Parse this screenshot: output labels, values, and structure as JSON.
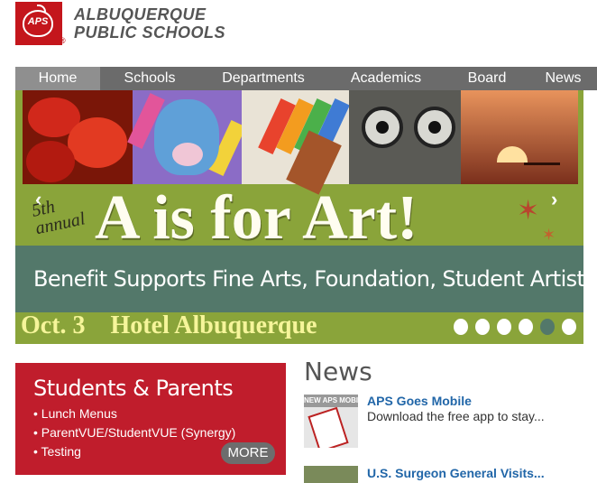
{
  "header": {
    "logo_text": "APS",
    "org_name_line1": "ALBUQUERQUE",
    "org_name_line2": "PUBLIC SCHOOLS",
    "registered_mark": "®"
  },
  "nav": {
    "items": [
      {
        "label": "Home",
        "active": true
      },
      {
        "label": "Schools"
      },
      {
        "label": "Departments"
      },
      {
        "label": "Academics"
      },
      {
        "label": "Board"
      },
      {
        "label": "News"
      }
    ]
  },
  "banner": {
    "prev_arrow": "‹",
    "next_arrow": "›",
    "annual_line1": "5th",
    "annual_line2": "annual",
    "headline": "A is for Art!",
    "subtitle": "Benefit Supports Fine Arts, Foundation, Student Artists",
    "event_date": "Oct. 3",
    "event_venue": "Hotel Albuquerque",
    "slide_count": 6,
    "active_slide": 5
  },
  "students_parents": {
    "title": "Students & Parents",
    "links": [
      "Lunch Menus",
      "ParentVUE/StudentVUE (Synergy)",
      "Testing"
    ],
    "more_label": "MORE"
  },
  "news": {
    "heading": "News",
    "items": [
      {
        "title": "APS Goes Mobile",
        "snippet": "Download the free app to stay...",
        "thumb_text": "NEW APS MOBILE"
      },
      {
        "title": "U.S. Surgeon General Visits...",
        "snippet": ""
      }
    ]
  },
  "colors": {
    "brand_red": "#c4161c",
    "nav_gray": "#6b6b6b",
    "banner_green": "#8aa43a",
    "banner_teal": "#53786a",
    "link_blue": "#2166a8"
  }
}
